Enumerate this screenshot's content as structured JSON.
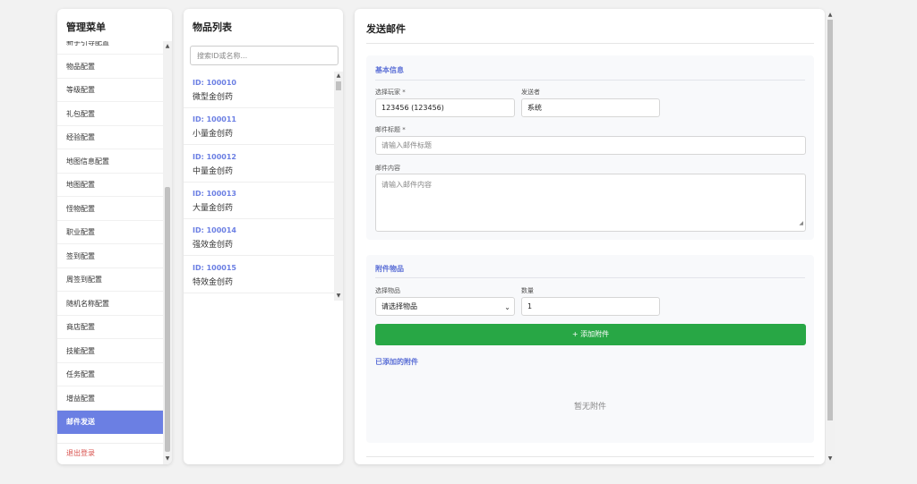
{
  "sidebar": {
    "title": "管理菜单",
    "items": [
      {
        "label": "新手引导配置"
      },
      {
        "label": "物品配置"
      },
      {
        "label": "等级配置"
      },
      {
        "label": "礼包配置"
      },
      {
        "label": "经验配置"
      },
      {
        "label": "地图信息配置"
      },
      {
        "label": "地图配置"
      },
      {
        "label": "怪物配置"
      },
      {
        "label": "职业配置"
      },
      {
        "label": "签到配置"
      },
      {
        "label": "周签到配置"
      },
      {
        "label": "随机名称配置"
      },
      {
        "label": "商店配置"
      },
      {
        "label": "技能配置"
      },
      {
        "label": "任务配置"
      },
      {
        "label": "增益配置"
      },
      {
        "label": "邮件发送"
      }
    ],
    "active_index": 16,
    "logout_label": "退出登录"
  },
  "item_list": {
    "title": "物品列表",
    "search_placeholder": "搜索ID或名称...",
    "items": [
      {
        "id": "ID: 100010",
        "name": "微型金创药"
      },
      {
        "id": "ID: 100011",
        "name": "小量金创药"
      },
      {
        "id": "ID: 100012",
        "name": "中量金创药"
      },
      {
        "id": "ID: 100013",
        "name": "大量金创药"
      },
      {
        "id": "ID: 100014",
        "name": "强效金创药"
      },
      {
        "id": "ID: 100015",
        "name": "特效金创药"
      }
    ]
  },
  "main": {
    "title": "发送邮件",
    "basic": {
      "title": "基本信息",
      "player_label": "选择玩家 *",
      "player_value": "123456 (123456)",
      "sender_label": "发送者",
      "sender_value": "系统",
      "subject_label": "邮件标题 *",
      "subject_placeholder": "请输入邮件标题",
      "content_label": "邮件内容",
      "content_placeholder": "请输入邮件内容"
    },
    "attachments": {
      "title": "附件物品",
      "item_label": "选择物品",
      "item_value": "请选择物品",
      "qty_label": "数量",
      "qty_value": "1",
      "add_button": "+ 添加附件",
      "added_title": "已添加的附件",
      "empty_text": "暂无附件"
    }
  }
}
